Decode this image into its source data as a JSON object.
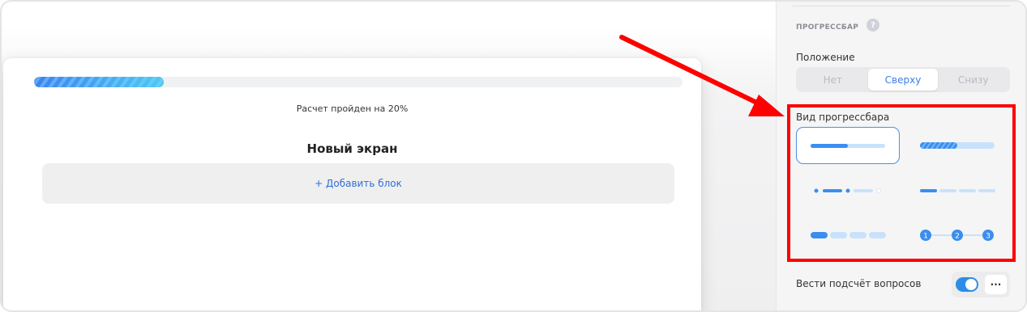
{
  "preview": {
    "progress_fraction": 0.2,
    "progress_text": "Расчет пройден на 20%",
    "screen_title": "Новый экран",
    "add_block_label": "+ Добавить блок"
  },
  "panel": {
    "section_title": "ПРОГРЕССБАР",
    "help_icon": "?",
    "position_label": "Положение",
    "position_options": [
      "Нет",
      "Сверху",
      "Снизу"
    ],
    "position_selected": "Сверху",
    "view_label": "Вид прогрессбара",
    "view_styles": [
      {
        "name": "line",
        "selected": true
      },
      {
        "name": "striped-line",
        "selected": false
      },
      {
        "name": "dots-and-dashes",
        "selected": false
      },
      {
        "name": "dashes",
        "selected": false
      },
      {
        "name": "pill-segments",
        "selected": false
      },
      {
        "name": "numbered-steps",
        "selected": false
      }
    ],
    "step_numbers": [
      "1",
      "2",
      "3"
    ],
    "count_questions_label": "Вести подсчёт вопросов",
    "count_questions_enabled": true,
    "more_icon": "···"
  },
  "colors": {
    "accent": "#3a7ee8",
    "annotation": "#ff0000"
  }
}
